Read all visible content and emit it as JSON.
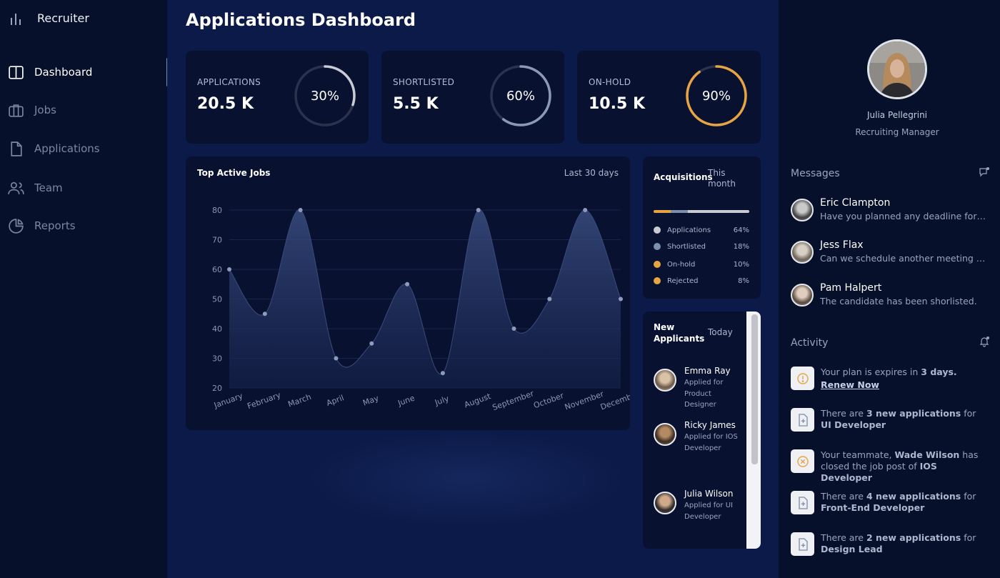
{
  "app": {
    "brand": "Recruiter"
  },
  "sidebar": {
    "items": [
      {
        "label": "Dashboard",
        "icon": "layout-columns-icon",
        "active": true
      },
      {
        "label": "Jobs",
        "icon": "briefcase-icon",
        "active": false
      },
      {
        "label": "Applications",
        "icon": "file-icon",
        "active": false
      },
      {
        "label": "Team",
        "icon": "users-icon",
        "active": false
      },
      {
        "label": "Reports",
        "icon": "pie-chart-icon",
        "active": false
      }
    ]
  },
  "main": {
    "title": "Applications Dashboard",
    "stats": [
      {
        "label": "APPLICATIONS",
        "value": "20.5 K",
        "percent_label": "30%",
        "percent": 30,
        "color": "#c9ccd4"
      },
      {
        "label": "SHORTLISTED",
        "value": "5.5 K",
        "percent_label": "60%",
        "percent": 60,
        "color": "#8a9ab5"
      },
      {
        "label": "ON-HOLD",
        "value": "10.5 K",
        "percent_label": "90%",
        "percent": 90,
        "color": "#e7a443"
      }
    ],
    "top_jobs": {
      "title": "Top Active Jobs",
      "range": "Last 30 days"
    },
    "acquisitions": {
      "title": "Acquisitions",
      "period": "This month",
      "items": [
        {
          "label": "Applications",
          "pct": "64%",
          "value": 64,
          "color": "#c8cbd2"
        },
        {
          "label": "Shortlisted",
          "pct": "18%",
          "value": 18,
          "color": "#7d8fad"
        },
        {
          "label": "On-hold",
          "pct": "10%",
          "value": 10,
          "color": "#e7a443"
        },
        {
          "label": "Rejected",
          "pct": "8%",
          "value": 8,
          "color": "#e7a443"
        }
      ]
    },
    "new_applicants": {
      "title": "New Applicants",
      "period": "Today",
      "items": [
        {
          "name": "Emma Ray",
          "role": "Applied for Product Designer"
        },
        {
          "name": "Ricky James",
          "role": "Applied for IOS Developer"
        },
        {
          "name": "Julia Wilson",
          "role": "Applied for UI Developer"
        }
      ]
    }
  },
  "chart_data": {
    "type": "area",
    "title": "Top Active Jobs",
    "categories": [
      "January",
      "February",
      "March",
      "April",
      "May",
      "June",
      "July",
      "August",
      "September",
      "October",
      "November",
      "December"
    ],
    "values": [
      60,
      45,
      80,
      30,
      35,
      55,
      25,
      80,
      40,
      50,
      80,
      50
    ],
    "ylim": [
      20,
      80
    ],
    "yticks": [
      80,
      70,
      60,
      50,
      40,
      30,
      20
    ],
    "grid": true,
    "color": "#4a5f93"
  },
  "profile": {
    "name": "Julia Pellegrini",
    "role": "Recruiting Manager"
  },
  "messages": {
    "title": "Messages",
    "items": [
      {
        "name": "Eric Clampton",
        "text": "Have you planned any deadline for this?"
      },
      {
        "name": "Jess Flax",
        "text": "Can we schedule another meeting for next week?"
      },
      {
        "name": "Pam Halpert",
        "text": "The candidate has been shorlisted."
      }
    ]
  },
  "activity": {
    "title": "Activity",
    "items": [
      {
        "icon": "alert-icon",
        "pre": "Your plan is expires in ",
        "bold1": "3 days.",
        "mid": "",
        "bold2": "",
        "link": "Renew Now"
      },
      {
        "icon": "add-file-icon",
        "pre": "There are ",
        "bold1": "3 new applications",
        "mid": " for ",
        "bold2": "UI Developer",
        "link": ""
      },
      {
        "icon": "cancel-icon",
        "pre": "Your teammate, ",
        "bold1": "Wade Wilson",
        "mid": " has closed the job post of ",
        "bold2": "IOS Developer",
        "link": ""
      },
      {
        "icon": "add-file-icon",
        "pre": "There are ",
        "bold1": "4 new applications",
        "mid": " for ",
        "bold2": "Front-End Developer",
        "link": ""
      },
      {
        "icon": "add-file-icon",
        "pre": "There are ",
        "bold1": "2 new applications",
        "mid": " for ",
        "bold2": "Design Lead",
        "link": ""
      }
    ]
  }
}
